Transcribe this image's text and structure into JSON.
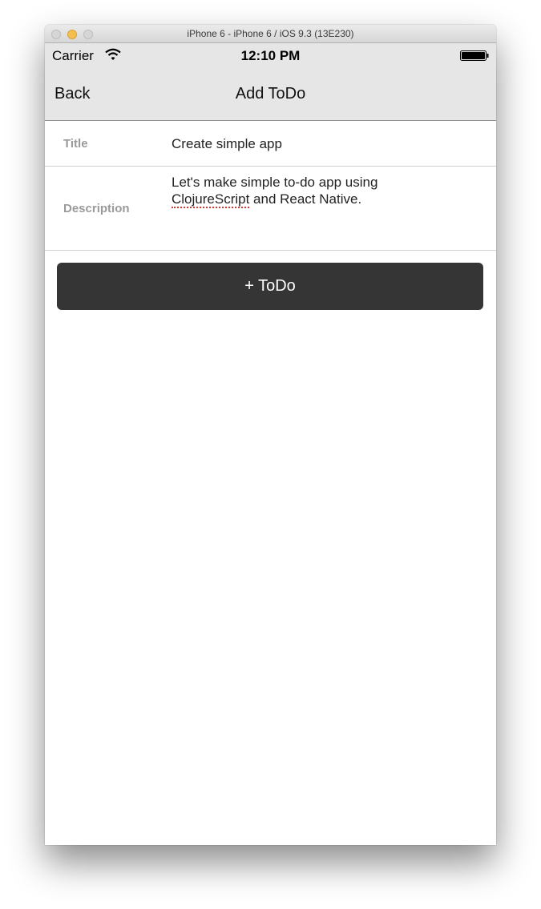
{
  "window": {
    "title": "iPhone 6 - iPhone 6 / iOS 9.3 (13E230)"
  },
  "status_bar": {
    "carrier": "Carrier",
    "time": "12:10 PM"
  },
  "nav": {
    "back_label": "Back",
    "title": "Add ToDo"
  },
  "form": {
    "title_label": "Title",
    "title_value": "Create simple app",
    "description_label": "Description",
    "description_line1": "Let's make simple to-do app using",
    "description_line2_misspelled": "ClojureScript",
    "description_line2_rest": " and React Native."
  },
  "add_button": {
    "label": "+ ToDo"
  }
}
